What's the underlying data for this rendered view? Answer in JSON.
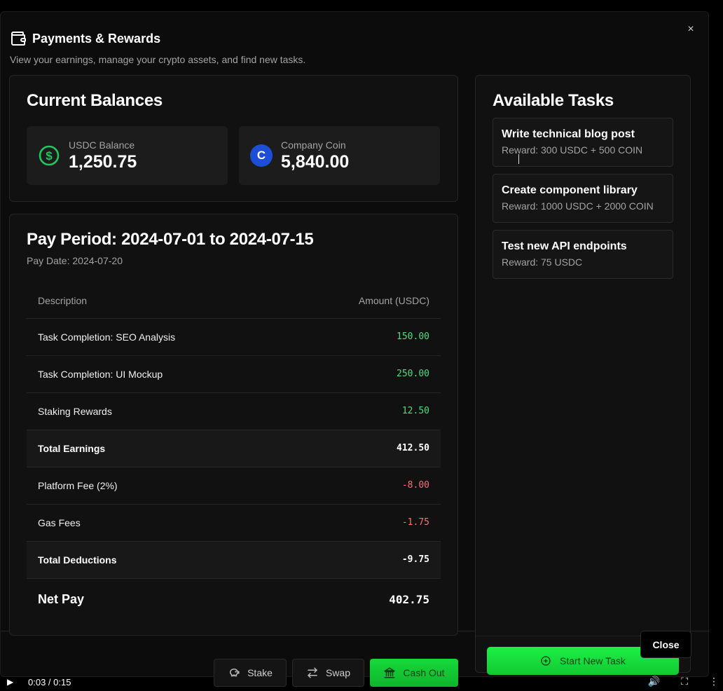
{
  "modal": {
    "title": "Payments & Rewards",
    "subtitle": "View your earnings, manage your crypto assets, and find new tasks.",
    "close_icon": "×"
  },
  "balances": {
    "title": "Current Balances",
    "items": [
      {
        "label": "USDC Balance",
        "value": "1,250.75",
        "icon": "dollar-circle-icon",
        "color": "#22c55e"
      },
      {
        "label": "Company Coin",
        "value": "5,840.00",
        "icon": "coin-icon",
        "icon_text": "C",
        "color": "#1d4ed8"
      }
    ]
  },
  "pay_period": {
    "title": "Pay Period: 2024-07-01 to 2024-07-15",
    "pay_date": "Pay Date: 2024-07-20",
    "columns": [
      "Description",
      "Amount (USDC)"
    ],
    "rows": [
      {
        "description": "Task Completion: SEO Analysis",
        "amount": "150.00",
        "kind": "pos"
      },
      {
        "description": "Task Completion: UI Mockup",
        "amount": "250.00",
        "kind": "pos"
      },
      {
        "description": "Staking Rewards",
        "amount": "12.50",
        "kind": "pos"
      },
      {
        "description": "Total Earnings",
        "amount": "412.50",
        "kind": "total"
      },
      {
        "description": "Platform Fee (2%)",
        "amount": "-8.00",
        "kind": "neg"
      },
      {
        "description": "Gas Fees",
        "amount": "-1.75",
        "kind": "neg"
      },
      {
        "description": "Total Deductions",
        "amount": "-9.75",
        "kind": "total"
      },
      {
        "description": "Net Pay",
        "amount": "402.75",
        "kind": "net"
      }
    ]
  },
  "tasks": {
    "title": "Available Tasks",
    "items": [
      {
        "title": "Write technical blog post",
        "reward": "Reward: 300 USDC + 500 COIN"
      },
      {
        "title": "Create component library",
        "reward": "Reward: 1000 USDC + 2000 COIN"
      },
      {
        "title": "Test new API endpoints",
        "reward": "Reward: 75 USDC"
      }
    ],
    "start_button": "Start New Task"
  },
  "actions": {
    "stake": "Stake",
    "swap": "Swap",
    "cash_out": "Cash Out",
    "close": "Close"
  },
  "video": {
    "time": "0:03 / 0:15"
  },
  "colors": {
    "positive": "#4ade80",
    "negative": "#f87171",
    "accent_green": "#16d93a"
  }
}
